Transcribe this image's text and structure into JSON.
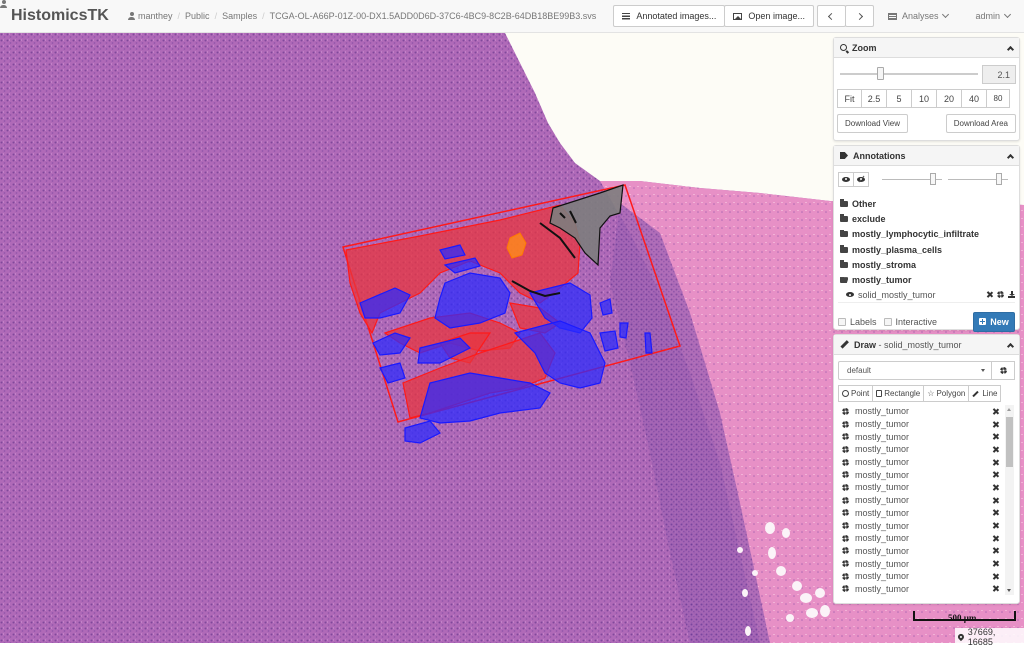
{
  "header": {
    "brand": "HistomicsTK",
    "breadcrumb": [
      "manthey",
      "Public",
      "Samples",
      "TCGA-OL-A66P-01Z-00-DX1.5ADD0D6D-37C6-4BC9-8C2B-64DB18BE99B3.svs"
    ],
    "annotated_images_label": "Annotated images...",
    "open_image_label": "Open image...",
    "analyses_label": "Analyses",
    "user_label": "admin",
    "icons": {
      "user": "user-icon",
      "annotated_images": "list-icon",
      "open_image": "image-icon",
      "prev": "chevron-left-icon",
      "next": "chevron-right-icon",
      "analyses": "tasks-icon",
      "dropdown": "chevron-down-icon"
    }
  },
  "zoom_panel": {
    "title": "Zoom",
    "value": "2.1",
    "slider_fraction": 0.29,
    "presets": [
      "Fit",
      "2.5",
      "5",
      "10",
      "20",
      "40",
      "80"
    ],
    "download_view_label": "Download View",
    "download_area_label": "Download Area"
  },
  "annotations_panel": {
    "title": "Annotations",
    "opacity_fraction": 0.85,
    "fill_opacity_fraction": 0.85,
    "groups": [
      "Other",
      "exclude",
      "mostly_lymphocytic_infiltrate",
      "mostly_plasma_cells",
      "mostly_stroma",
      "mostly_tumor"
    ],
    "expanded_group": "mostly_tumor",
    "annotation": {
      "name": "solid_mostly_tumor",
      "visible": true
    },
    "labels_label": "Labels",
    "labels_checked": false,
    "interactive_label": "Interactive",
    "interactive_checked": false,
    "new_label": "New"
  },
  "draw_panel": {
    "title": "Draw",
    "subtitle": " - solid_mostly_tumor",
    "style_value": "default",
    "shape_buttons": [
      "Point",
      "Rectangle",
      "Polygon",
      "Line"
    ],
    "elements": [
      "mostly_tumor",
      "mostly_tumor",
      "mostly_tumor",
      "mostly_tumor",
      "mostly_tumor",
      "mostly_tumor",
      "mostly_tumor",
      "mostly_tumor",
      "mostly_tumor",
      "mostly_tumor",
      "mostly_tumor",
      "mostly_tumor",
      "mostly_tumor",
      "mostly_tumor",
      "mostly_tumor"
    ]
  },
  "viewer": {
    "scale_label": "500 µm",
    "coordinates": "37669, 16685",
    "colors": {
      "tissue": "#b06ab8",
      "stroma": "#e58fc4",
      "background": "#fdfcf6",
      "tumor_fill": "#e8363f",
      "tumor_stroke": "#ff0000",
      "stroma_annot": "#2222ff",
      "exclude_fill": "#7d7d7d",
      "orange_annot": "#ff8c1a"
    }
  }
}
